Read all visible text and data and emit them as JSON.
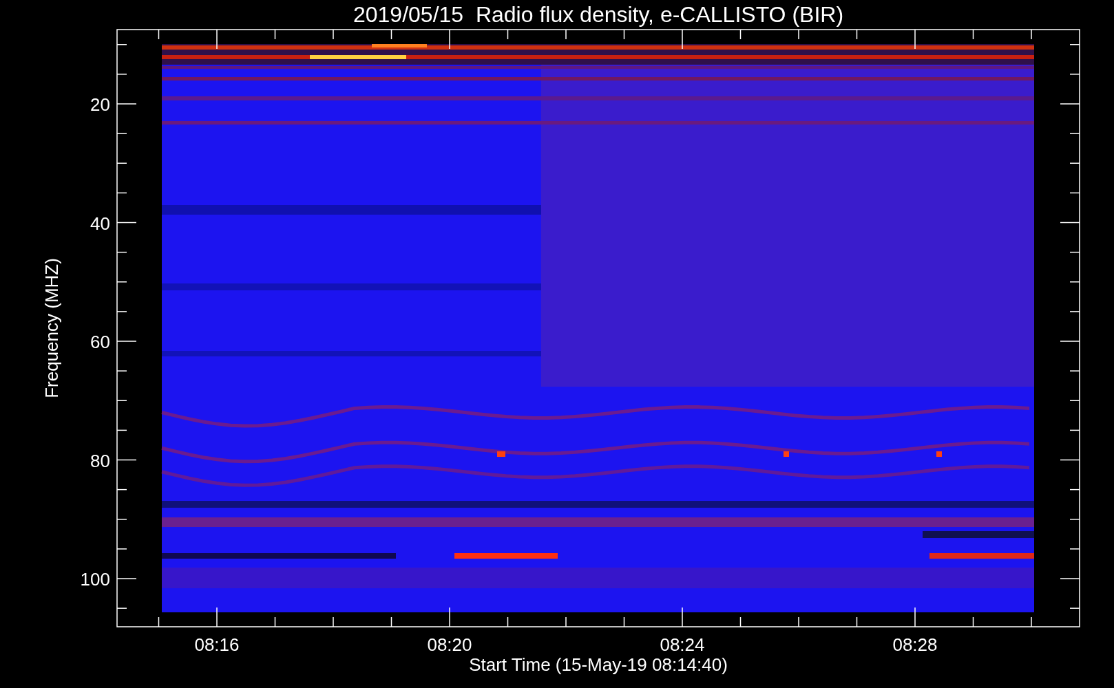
{
  "title": "2019/05/15  Radio flux density, e-CALLISTO (BIR)",
  "y_axis": {
    "label": "Frequency (MHZ)",
    "ticks": [
      "20",
      "40",
      "60",
      "80",
      "100"
    ]
  },
  "x_axis": {
    "label": "Start Time (15-May-19 08:14:40)",
    "ticks": [
      "08:16",
      "08:20",
      "08:24",
      "08:28"
    ]
  }
}
